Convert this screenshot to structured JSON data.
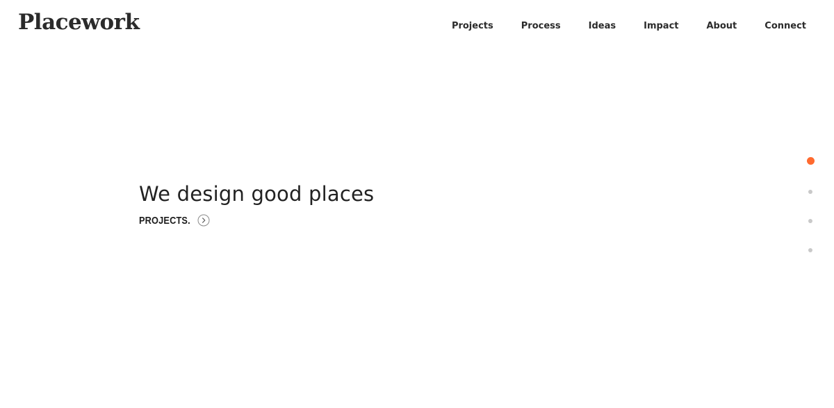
{
  "brand": {
    "name": "Placework"
  },
  "nav": {
    "items": [
      {
        "label": "Projects"
      },
      {
        "label": "Process"
      },
      {
        "label": "Ideas"
      },
      {
        "label": "Impact"
      },
      {
        "label": "About"
      },
      {
        "label": "Connect"
      }
    ]
  },
  "hero": {
    "title": "We design good places",
    "cta_label": "PROJECTS."
  },
  "slider": {
    "count": 4,
    "active_index": 0,
    "active_color": "#ff6a2f",
    "idle_color": "#c9c9c9"
  },
  "icons": {
    "cta": "chevron-right-circle-icon"
  }
}
